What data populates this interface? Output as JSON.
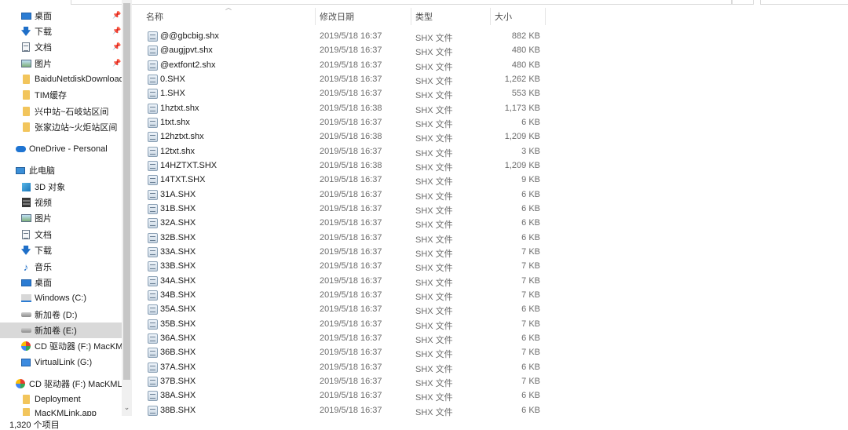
{
  "nav": {
    "quick_access": [
      {
        "label": "桌面",
        "icon": "desktop-icon",
        "pinned": true
      },
      {
        "label": "下载",
        "icon": "download-icon",
        "pinned": true
      },
      {
        "label": "文档",
        "icon": "documents-icon",
        "pinned": true
      },
      {
        "label": "图片",
        "icon": "pictures-icon",
        "pinned": true
      },
      {
        "label": "BaiduNetdiskDownload",
        "icon": "folder-icon",
        "pinned": false
      },
      {
        "label": "TIM缓存",
        "icon": "folder-icon",
        "pinned": false
      },
      {
        "label": "兴中站~石岐站区间",
        "icon": "folder-icon",
        "pinned": false
      },
      {
        "label": "张家边站~火炬站区间",
        "icon": "folder-icon",
        "pinned": false
      }
    ],
    "onedrive": "OneDrive - Personal",
    "this_pc": "此电脑",
    "pc_items": [
      {
        "label": "3D 对象",
        "icon": "3d-objects-icon"
      },
      {
        "label": "视频",
        "icon": "videos-icon"
      },
      {
        "label": "图片",
        "icon": "pictures-icon"
      },
      {
        "label": "文档",
        "icon": "documents-icon"
      },
      {
        "label": "下载",
        "icon": "download-icon"
      },
      {
        "label": "音乐",
        "icon": "music-icon"
      },
      {
        "label": "桌面",
        "icon": "desktop-icon"
      },
      {
        "label": "Windows (C:)",
        "icon": "windows-drive-icon"
      },
      {
        "label": "新加卷 (D:)",
        "icon": "drive-icon"
      },
      {
        "label": "新加卷 (E:)",
        "icon": "drive-icon",
        "selected": true
      },
      {
        "label": "CD 驱动器 (F:) MacKMLink",
        "icon": "cd-drive-icon"
      },
      {
        "label": "VirtualLink (G:)",
        "icon": "virtual-drive-icon"
      }
    ],
    "cd_root": "CD 驱动器 (F:) MacKMLink",
    "cd_children": [
      {
        "label": "Deployment",
        "icon": "folder-icon"
      },
      {
        "label": "MacKMLink.app",
        "icon": "folder-icon"
      }
    ]
  },
  "columns": {
    "name": "名称",
    "date": "修改日期",
    "type": "类型",
    "size": "大小"
  },
  "files": [
    {
      "name": "@@gbcbig.shx",
      "date": "2019/5/18 16:37",
      "type": "SHX 文件",
      "size": "882 KB"
    },
    {
      "name": "@augjpvt.shx",
      "date": "2019/5/18 16:37",
      "type": "SHX 文件",
      "size": "480 KB"
    },
    {
      "name": "@extfont2.shx",
      "date": "2019/5/18 16:37",
      "type": "SHX 文件",
      "size": "480 KB"
    },
    {
      "name": "0.SHX",
      "date": "2019/5/18 16:37",
      "type": "SHX 文件",
      "size": "1,262 KB"
    },
    {
      "name": "1.SHX",
      "date": "2019/5/18 16:37",
      "type": "SHX 文件",
      "size": "553 KB"
    },
    {
      "name": "1hztxt.shx",
      "date": "2019/5/18 16:38",
      "type": "SHX 文件",
      "size": "1,173 KB"
    },
    {
      "name": "1txt.shx",
      "date": "2019/5/18 16:37",
      "type": "SHX 文件",
      "size": "6 KB"
    },
    {
      "name": "12hztxt.shx",
      "date": "2019/5/18 16:38",
      "type": "SHX 文件",
      "size": "1,209 KB"
    },
    {
      "name": "12txt.shx",
      "date": "2019/5/18 16:37",
      "type": "SHX 文件",
      "size": "3 KB"
    },
    {
      "name": "14HZTXT.SHX",
      "date": "2019/5/18 16:38",
      "type": "SHX 文件",
      "size": "1,209 KB"
    },
    {
      "name": "14TXT.SHX",
      "date": "2019/5/18 16:37",
      "type": "SHX 文件",
      "size": "9 KB"
    },
    {
      "name": "31A.SHX",
      "date": "2019/5/18 16:37",
      "type": "SHX 文件",
      "size": "6 KB"
    },
    {
      "name": "31B.SHX",
      "date": "2019/5/18 16:37",
      "type": "SHX 文件",
      "size": "6 KB"
    },
    {
      "name": "32A.SHX",
      "date": "2019/5/18 16:37",
      "type": "SHX 文件",
      "size": "6 KB"
    },
    {
      "name": "32B.SHX",
      "date": "2019/5/18 16:37",
      "type": "SHX 文件",
      "size": "6 KB"
    },
    {
      "name": "33A.SHX",
      "date": "2019/5/18 16:37",
      "type": "SHX 文件",
      "size": "7 KB"
    },
    {
      "name": "33B.SHX",
      "date": "2019/5/18 16:37",
      "type": "SHX 文件",
      "size": "7 KB"
    },
    {
      "name": "34A.SHX",
      "date": "2019/5/18 16:37",
      "type": "SHX 文件",
      "size": "7 KB"
    },
    {
      "name": "34B.SHX",
      "date": "2019/5/18 16:37",
      "type": "SHX 文件",
      "size": "7 KB"
    },
    {
      "name": "35A.SHX",
      "date": "2019/5/18 16:37",
      "type": "SHX 文件",
      "size": "6 KB"
    },
    {
      "name": "35B.SHX",
      "date": "2019/5/18 16:37",
      "type": "SHX 文件",
      "size": "7 KB"
    },
    {
      "name": "36A.SHX",
      "date": "2019/5/18 16:37",
      "type": "SHX 文件",
      "size": "6 KB"
    },
    {
      "name": "36B.SHX",
      "date": "2019/5/18 16:37",
      "type": "SHX 文件",
      "size": "7 KB"
    },
    {
      "name": "37A.SHX",
      "date": "2019/5/18 16:37",
      "type": "SHX 文件",
      "size": "6 KB"
    },
    {
      "name": "37B.SHX",
      "date": "2019/5/18 16:37",
      "type": "SHX 文件",
      "size": "7 KB"
    },
    {
      "name": "38A.SHX",
      "date": "2019/5/18 16:37",
      "type": "SHX 文件",
      "size": "6 KB"
    },
    {
      "name": "38B.SHX",
      "date": "2019/5/18 16:37",
      "type": "SHX 文件",
      "size": "6 KB"
    }
  ],
  "status": {
    "item_count": "1,320 个项目"
  },
  "colors": {
    "selected_bg": "#d9d9d9",
    "accent": "#2b7cd3"
  }
}
